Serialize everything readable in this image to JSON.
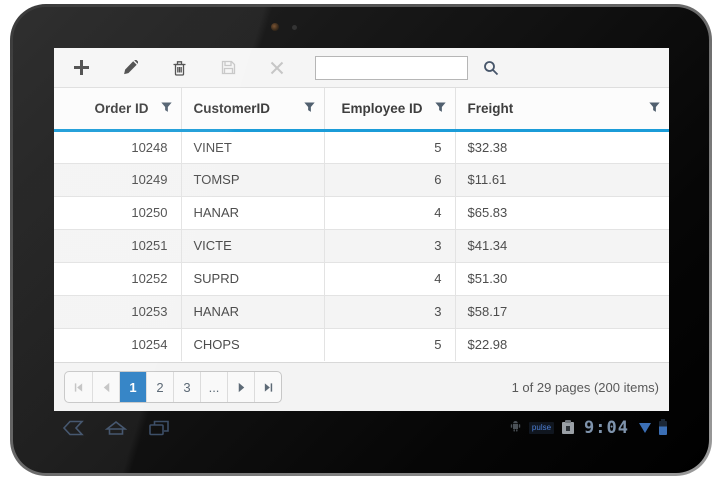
{
  "toolbar": {
    "icons": [
      {
        "name": "add",
        "enabled": true
      },
      {
        "name": "edit",
        "enabled": true
      },
      {
        "name": "delete",
        "enabled": true
      },
      {
        "name": "save",
        "enabled": false
      },
      {
        "name": "cancel",
        "enabled": false
      }
    ],
    "search_value": "",
    "search_placeholder": ""
  },
  "grid": {
    "columns": [
      {
        "label": "Order ID",
        "align": "right"
      },
      {
        "label": "CustomerID",
        "align": "left"
      },
      {
        "label": "Employee ID",
        "align": "right"
      },
      {
        "label": "Freight",
        "align": "left"
      }
    ],
    "rows": [
      [
        "10248",
        "VINET",
        "5",
        "$32.38"
      ],
      [
        "10249",
        "TOMSP",
        "6",
        "$11.61"
      ],
      [
        "10250",
        "HANAR",
        "4",
        "$65.83"
      ],
      [
        "10251",
        "VICTE",
        "3",
        "$41.34"
      ],
      [
        "10252",
        "SUPRD",
        "4",
        "$51.30"
      ],
      [
        "10253",
        "HANAR",
        "3",
        "$58.17"
      ],
      [
        "10254",
        "CHOPS",
        "5",
        "$22.98"
      ]
    ]
  },
  "pager": {
    "pages": [
      "1",
      "2",
      "3",
      "..."
    ],
    "current_page": "1",
    "info": "1 of 29 pages (200 items)"
  },
  "status_bar": {
    "clock": "9:04",
    "pulse_label": "pulse"
  },
  "colors": {
    "header_accent": "#1b9cd8",
    "selected_page": "#2c80c4",
    "status_accent": "#3b6fb5"
  }
}
